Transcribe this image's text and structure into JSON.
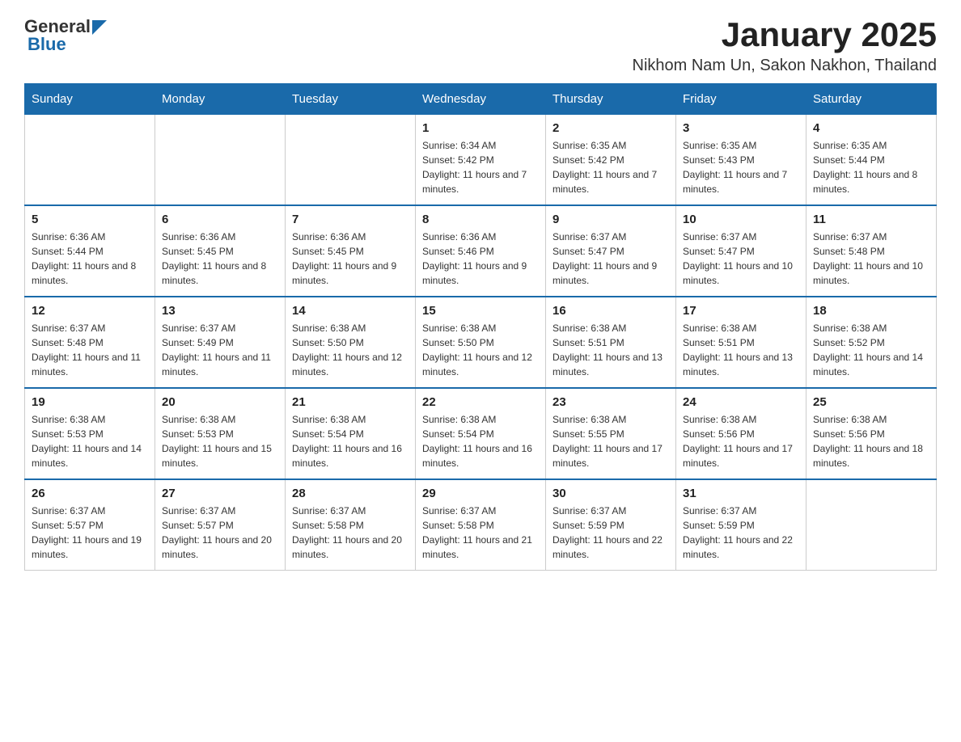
{
  "logo": {
    "text_general": "General",
    "text_blue": "Blue"
  },
  "title": "January 2025",
  "subtitle": "Nikhom Nam Un, Sakon Nakhon, Thailand",
  "days_of_week": [
    "Sunday",
    "Monday",
    "Tuesday",
    "Wednesday",
    "Thursday",
    "Friday",
    "Saturday"
  ],
  "weeks": [
    [
      {
        "day": "",
        "info": ""
      },
      {
        "day": "",
        "info": ""
      },
      {
        "day": "",
        "info": ""
      },
      {
        "day": "1",
        "info": "Sunrise: 6:34 AM\nSunset: 5:42 PM\nDaylight: 11 hours and 7 minutes."
      },
      {
        "day": "2",
        "info": "Sunrise: 6:35 AM\nSunset: 5:42 PM\nDaylight: 11 hours and 7 minutes."
      },
      {
        "day": "3",
        "info": "Sunrise: 6:35 AM\nSunset: 5:43 PM\nDaylight: 11 hours and 7 minutes."
      },
      {
        "day": "4",
        "info": "Sunrise: 6:35 AM\nSunset: 5:44 PM\nDaylight: 11 hours and 8 minutes."
      }
    ],
    [
      {
        "day": "5",
        "info": "Sunrise: 6:36 AM\nSunset: 5:44 PM\nDaylight: 11 hours and 8 minutes."
      },
      {
        "day": "6",
        "info": "Sunrise: 6:36 AM\nSunset: 5:45 PM\nDaylight: 11 hours and 8 minutes."
      },
      {
        "day": "7",
        "info": "Sunrise: 6:36 AM\nSunset: 5:45 PM\nDaylight: 11 hours and 9 minutes."
      },
      {
        "day": "8",
        "info": "Sunrise: 6:36 AM\nSunset: 5:46 PM\nDaylight: 11 hours and 9 minutes."
      },
      {
        "day": "9",
        "info": "Sunrise: 6:37 AM\nSunset: 5:47 PM\nDaylight: 11 hours and 9 minutes."
      },
      {
        "day": "10",
        "info": "Sunrise: 6:37 AM\nSunset: 5:47 PM\nDaylight: 11 hours and 10 minutes."
      },
      {
        "day": "11",
        "info": "Sunrise: 6:37 AM\nSunset: 5:48 PM\nDaylight: 11 hours and 10 minutes."
      }
    ],
    [
      {
        "day": "12",
        "info": "Sunrise: 6:37 AM\nSunset: 5:48 PM\nDaylight: 11 hours and 11 minutes."
      },
      {
        "day": "13",
        "info": "Sunrise: 6:37 AM\nSunset: 5:49 PM\nDaylight: 11 hours and 11 minutes."
      },
      {
        "day": "14",
        "info": "Sunrise: 6:38 AM\nSunset: 5:50 PM\nDaylight: 11 hours and 12 minutes."
      },
      {
        "day": "15",
        "info": "Sunrise: 6:38 AM\nSunset: 5:50 PM\nDaylight: 11 hours and 12 minutes."
      },
      {
        "day": "16",
        "info": "Sunrise: 6:38 AM\nSunset: 5:51 PM\nDaylight: 11 hours and 13 minutes."
      },
      {
        "day": "17",
        "info": "Sunrise: 6:38 AM\nSunset: 5:51 PM\nDaylight: 11 hours and 13 minutes."
      },
      {
        "day": "18",
        "info": "Sunrise: 6:38 AM\nSunset: 5:52 PM\nDaylight: 11 hours and 14 minutes."
      }
    ],
    [
      {
        "day": "19",
        "info": "Sunrise: 6:38 AM\nSunset: 5:53 PM\nDaylight: 11 hours and 14 minutes."
      },
      {
        "day": "20",
        "info": "Sunrise: 6:38 AM\nSunset: 5:53 PM\nDaylight: 11 hours and 15 minutes."
      },
      {
        "day": "21",
        "info": "Sunrise: 6:38 AM\nSunset: 5:54 PM\nDaylight: 11 hours and 16 minutes."
      },
      {
        "day": "22",
        "info": "Sunrise: 6:38 AM\nSunset: 5:54 PM\nDaylight: 11 hours and 16 minutes."
      },
      {
        "day": "23",
        "info": "Sunrise: 6:38 AM\nSunset: 5:55 PM\nDaylight: 11 hours and 17 minutes."
      },
      {
        "day": "24",
        "info": "Sunrise: 6:38 AM\nSunset: 5:56 PM\nDaylight: 11 hours and 17 minutes."
      },
      {
        "day": "25",
        "info": "Sunrise: 6:38 AM\nSunset: 5:56 PM\nDaylight: 11 hours and 18 minutes."
      }
    ],
    [
      {
        "day": "26",
        "info": "Sunrise: 6:37 AM\nSunset: 5:57 PM\nDaylight: 11 hours and 19 minutes."
      },
      {
        "day": "27",
        "info": "Sunrise: 6:37 AM\nSunset: 5:57 PM\nDaylight: 11 hours and 20 minutes."
      },
      {
        "day": "28",
        "info": "Sunrise: 6:37 AM\nSunset: 5:58 PM\nDaylight: 11 hours and 20 minutes."
      },
      {
        "day": "29",
        "info": "Sunrise: 6:37 AM\nSunset: 5:58 PM\nDaylight: 11 hours and 21 minutes."
      },
      {
        "day": "30",
        "info": "Sunrise: 6:37 AM\nSunset: 5:59 PM\nDaylight: 11 hours and 22 minutes."
      },
      {
        "day": "31",
        "info": "Sunrise: 6:37 AM\nSunset: 5:59 PM\nDaylight: 11 hours and 22 minutes."
      },
      {
        "day": "",
        "info": ""
      }
    ]
  ]
}
